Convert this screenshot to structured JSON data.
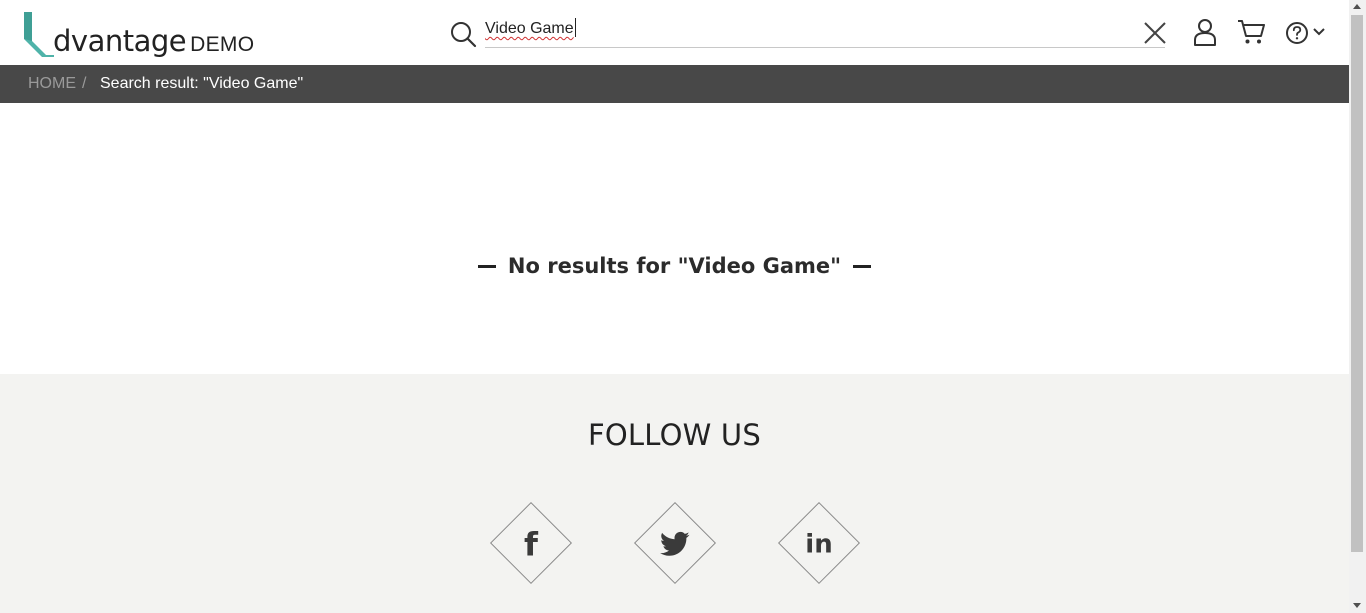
{
  "header": {
    "logo_word": "dvantage",
    "logo_suffix": "DEMO",
    "logo_color": "#4fb3a9",
    "search": {
      "value": "Video Game",
      "icon": "search-icon",
      "clear_icon": "close-icon"
    },
    "icons": [
      "user-icon",
      "cart-icon",
      "help-icon",
      "chevron-down-icon"
    ]
  },
  "breadcrumb": {
    "home": "HOME",
    "separator": "/",
    "current": "Search result: \"Video Game\""
  },
  "main": {
    "no_results_text": "No results for \"Video Game\""
  },
  "footer": {
    "title": "FOLLOW US",
    "background": "#f3f3f1",
    "social": [
      {
        "name": "facebook",
        "glyph": "f"
      },
      {
        "name": "twitter",
        "glyph": "twitter-bird-icon"
      },
      {
        "name": "linkedin",
        "glyph": "in"
      }
    ]
  },
  "colors": {
    "breadcrumb_bar": "#484848",
    "accent": "#4fb3a9"
  }
}
